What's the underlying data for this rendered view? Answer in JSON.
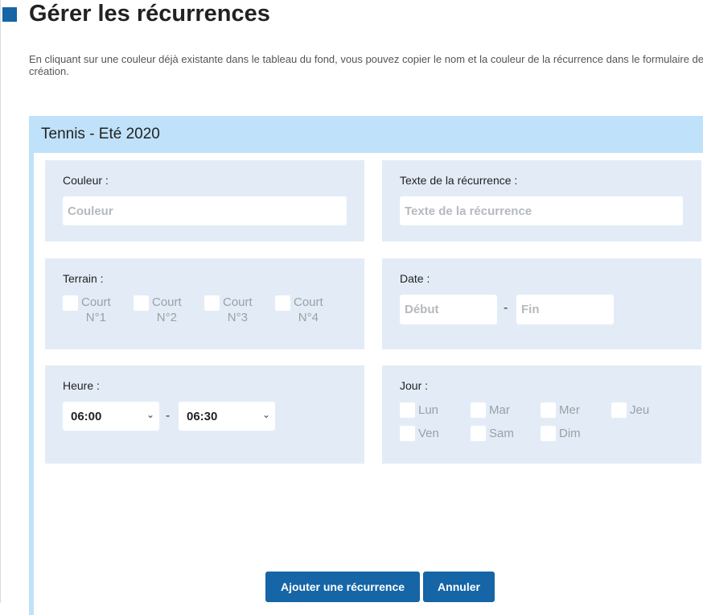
{
  "page": {
    "title": "Gérer les récurrences",
    "intro": "En cliquant sur une couleur déjà existante dans le tableau du fond, vous pouvez copier le nom et la couleur de la récurrence dans le formulaire de création."
  },
  "panel": {
    "title": "Tennis - Eté 2020"
  },
  "form": {
    "couleur": {
      "label": "Couleur :",
      "placeholder": "Couleur",
      "value": ""
    },
    "texte": {
      "label": "Texte de la récurrence :",
      "placeholder": "Texte de la récurrence",
      "value": ""
    },
    "terrain": {
      "label": "Terrain :",
      "courts": [
        {
          "line1": "Court",
          "line2": "N°1",
          "checked": false
        },
        {
          "line1": "Court",
          "line2": "N°2",
          "checked": false
        },
        {
          "line1": "Court",
          "line2": "N°3",
          "checked": false
        },
        {
          "line1": "Court",
          "line2": "N°4",
          "checked": false
        }
      ]
    },
    "date": {
      "label": "Date :",
      "start_placeholder": "Début",
      "end_placeholder": "Fin",
      "separator": "-"
    },
    "heure": {
      "label": "Heure :",
      "start": "06:00",
      "end": "06:30",
      "separator": "-"
    },
    "jour": {
      "label": "Jour :",
      "days": [
        "Lun",
        "Mar",
        "Mer",
        "Jeu",
        "Ven",
        "Sam",
        "Dim"
      ]
    }
  },
  "actions": {
    "add_label": "Ajouter une récurrence",
    "cancel_label": "Annuler"
  },
  "colors": {
    "accent": "#1565a7",
    "panel_header": "#bfe2fa",
    "card_bg": "#e3ecf6"
  }
}
